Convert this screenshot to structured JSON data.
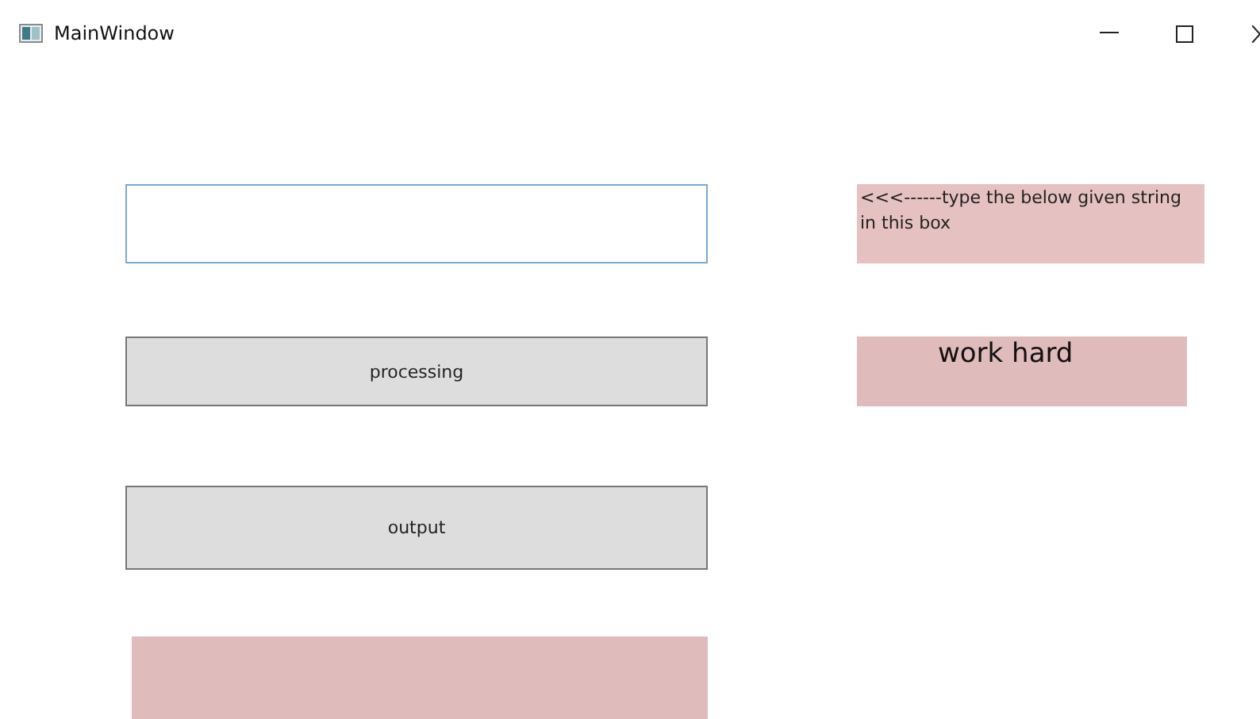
{
  "window": {
    "title": "MainWindow"
  },
  "buttons": [
    {
      "label": "processing"
    },
    {
      "label": "output"
    }
  ],
  "hint_label": "<<<------type the below given string in this box",
  "target_string": "work hard"
}
